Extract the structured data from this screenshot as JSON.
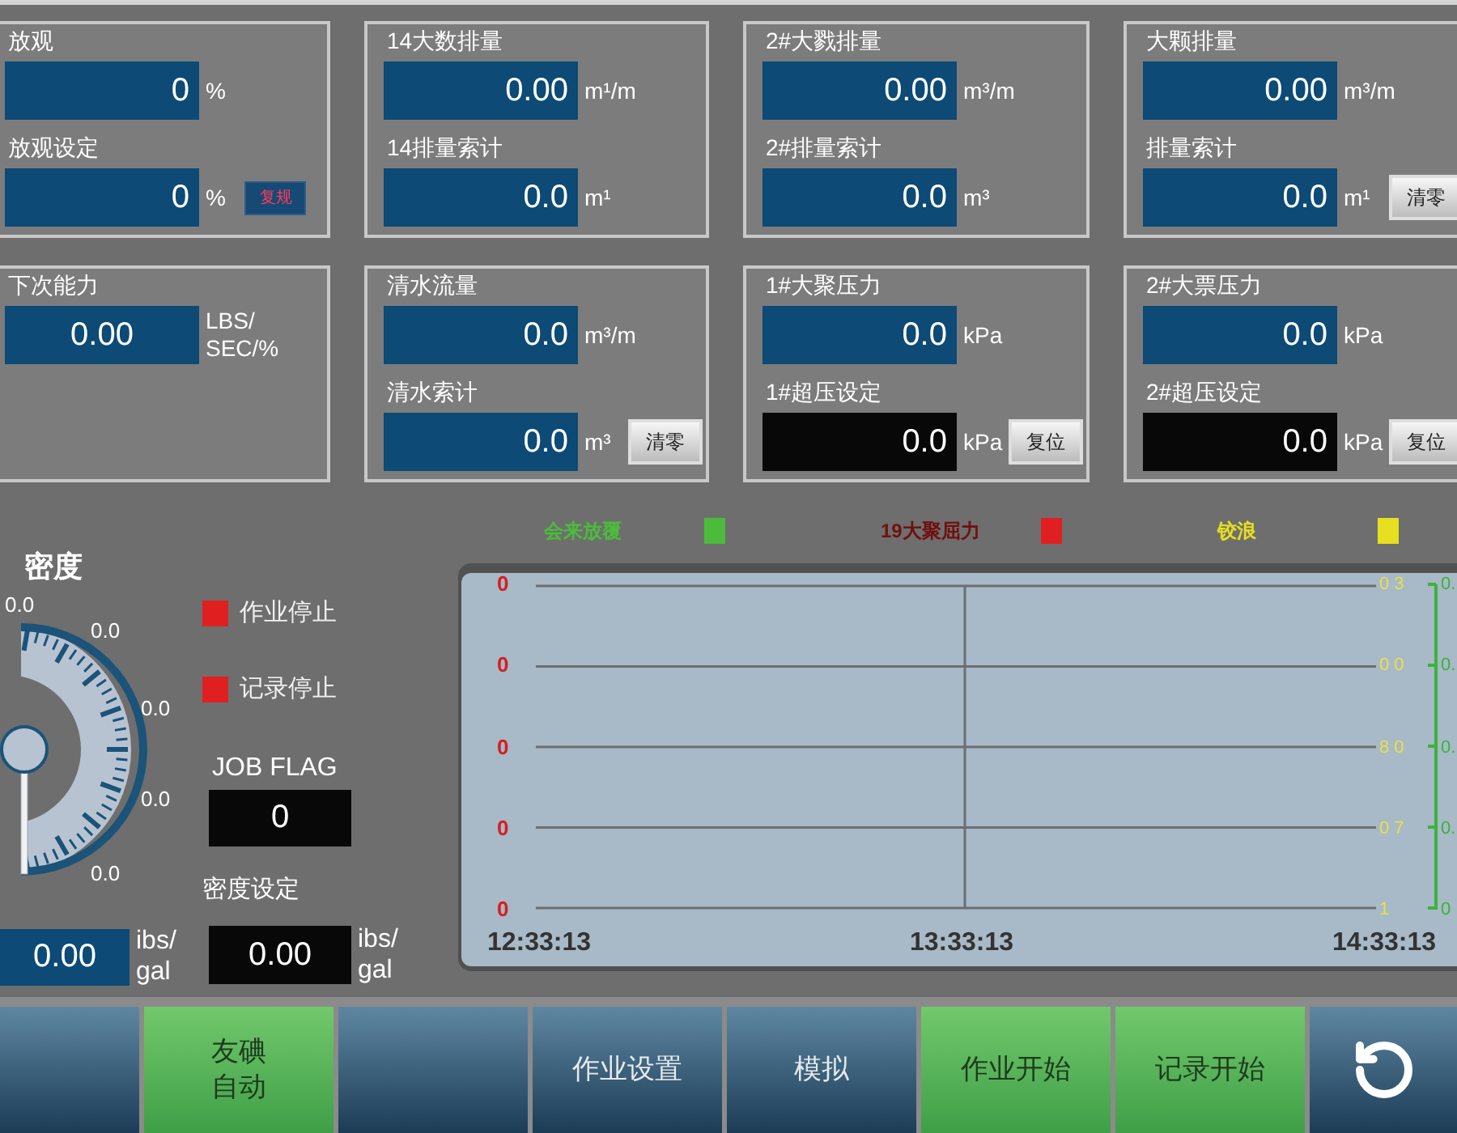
{
  "panels": [
    {
      "fields": [
        {
          "label": "放观",
          "value": "0",
          "unit": "%",
          "kind": "display"
        },
        {
          "label": "放观设定",
          "value": "0",
          "unit": "%",
          "kind": "display",
          "button": {
            "label": "复规",
            "kind": "alarm"
          }
        }
      ]
    },
    {
      "fields": [
        {
          "label": "14大数排量",
          "value": "0.00",
          "unit": "m¹/m",
          "kind": "display"
        },
        {
          "label": "14排量索计",
          "value": "0.0",
          "unit": "m¹",
          "kind": "display"
        }
      ]
    },
    {
      "fields": [
        {
          "label": "2#大戮排量",
          "value": "0.00",
          "unit": "m³/m",
          "kind": "display"
        },
        {
          "label": "2#排量索计",
          "value": "0.0",
          "unit": "m³",
          "kind": "display"
        }
      ]
    },
    {
      "fields": [
        {
          "label": "大颗排量",
          "value": "0.00",
          "unit": "m³/m",
          "kind": "display"
        },
        {
          "label": "排量索计",
          "value": "0.0",
          "unit": "m¹",
          "kind": "display",
          "button": {
            "label": "清零",
            "kind": "push"
          }
        }
      ]
    },
    {
      "fields": [
        {
          "label": "下次能力",
          "value": "0.00",
          "unit": "LBS/\nSEC/%",
          "kind": "readout"
        }
      ]
    },
    {
      "fields": [
        {
          "label": "清水流量",
          "value": "0.0",
          "unit": "m³/m",
          "kind": "display"
        },
        {
          "label": "清水索计",
          "value": "0.0",
          "unit": "m³",
          "kind": "display",
          "button": {
            "label": "清零",
            "kind": "push"
          }
        }
      ]
    },
    {
      "fields": [
        {
          "label": "1#大聚压力",
          "value": "0.0",
          "unit": "kPa",
          "kind": "display"
        },
        {
          "label": "1#超压设定",
          "value": "0.0",
          "unit": "kPa",
          "kind": "setting",
          "button": {
            "label": "复位",
            "kind": "push"
          }
        }
      ]
    },
    {
      "fields": [
        {
          "label": "2#大票压力",
          "value": "0.0",
          "unit": "kPa",
          "kind": "display"
        },
        {
          "label": "2#超压设定",
          "value": "0.0",
          "unit": "kPa",
          "kind": "setting",
          "button": {
            "label": "复位",
            "kind": "push"
          }
        }
      ]
    }
  ],
  "lower": {
    "density": {
      "title": "密度",
      "gauge_labels": [
        "0.0",
        "0.0",
        "0.0",
        "0.0",
        "0.0"
      ],
      "readout": {
        "value": "0.00",
        "unit": "ibs/\ngal",
        "kind": "readout"
      }
    },
    "indicators": [
      {
        "label": "作业停止",
        "color": "#e02020"
      },
      {
        "label": "记录停止",
        "color": "#e02020"
      }
    ],
    "job_flag": {
      "label": "JOB FLAG",
      "value": "0",
      "kind": "setpoint"
    },
    "density_setting": {
      "label": "密度设定",
      "value": "0.00",
      "unit": "ibs/\ngal",
      "kind": "setpoint"
    }
  },
  "trend": {
    "legend": [
      {
        "label": "会来放覆",
        "color": "#4cbb3c"
      },
      {
        "label": "19大聚屈力",
        "color": "#e02020"
      },
      {
        "label": "铰浪",
        "color": "#e6e020"
      }
    ],
    "left_axis": [
      "0",
      "0",
      "0",
      "0",
      "0"
    ],
    "right_axis": [
      "0 3",
      "0 0",
      "8 0",
      "0 7",
      "1"
    ],
    "far_right_axis": [
      "0.",
      "0.",
      "0.",
      "0.",
      "0"
    ],
    "times": [
      "12:33:13",
      "13:33:13",
      "14:33:13"
    ]
  },
  "buttons": [
    {
      "kind": "blank",
      "on": false
    },
    {
      "kind": "text",
      "lines": [
        "友碘",
        "自动"
      ],
      "on": true
    },
    {
      "kind": "blank",
      "on": false
    },
    {
      "kind": "text",
      "lines": [
        "作业设置"
      ],
      "on": false
    },
    {
      "kind": "text",
      "lines": [
        "模拟"
      ],
      "on": false
    },
    {
      "kind": "text",
      "lines": [
        "作业开始"
      ],
      "on": true
    },
    {
      "kind": "text",
      "lines": [
        "记录开始"
      ],
      "on": true
    },
    {
      "kind": "icon",
      "on": false
    }
  ]
}
